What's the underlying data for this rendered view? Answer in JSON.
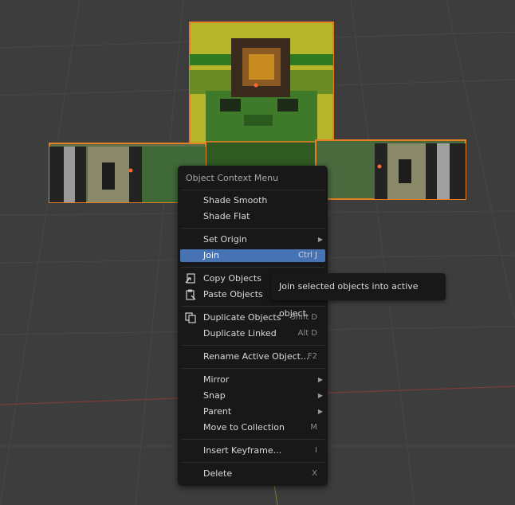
{
  "menu": {
    "title": "Object Context Menu",
    "items": [
      {
        "label": "Shade Smooth",
        "shortcut": ""
      },
      {
        "label": "Shade Flat",
        "shortcut": ""
      },
      {
        "label": "Set Origin",
        "shortcut": ""
      },
      {
        "label": "Join",
        "shortcut": "Ctrl J"
      },
      {
        "label": "Copy Objects",
        "shortcut": ""
      },
      {
        "label": "Paste Objects",
        "shortcut": ""
      },
      {
        "label": "Duplicate Objects",
        "shortcut": "Shift D"
      },
      {
        "label": "Duplicate Linked",
        "shortcut": "Alt D"
      },
      {
        "label": "Rename Active Object...",
        "shortcut": "F2"
      },
      {
        "label": "Mirror",
        "shortcut": ""
      },
      {
        "label": "Snap",
        "shortcut": ""
      },
      {
        "label": "Parent",
        "shortcut": ""
      },
      {
        "label": "Move to Collection",
        "shortcut": "M"
      },
      {
        "label": "Insert Keyframe...",
        "shortcut": "I"
      },
      {
        "label": "Delete",
        "shortcut": "X"
      }
    ]
  },
  "tooltip": {
    "text": "Join selected objects into active object."
  },
  "icons": {
    "copy": "copy-icon",
    "paste": "paste-icon",
    "duplicate": "duplicate-icon",
    "submenu": "submenu-arrow-icon"
  },
  "colors": {
    "highlight": "#4772b3",
    "selection_outline": "#e67e22",
    "menu_bg": "#181818"
  }
}
